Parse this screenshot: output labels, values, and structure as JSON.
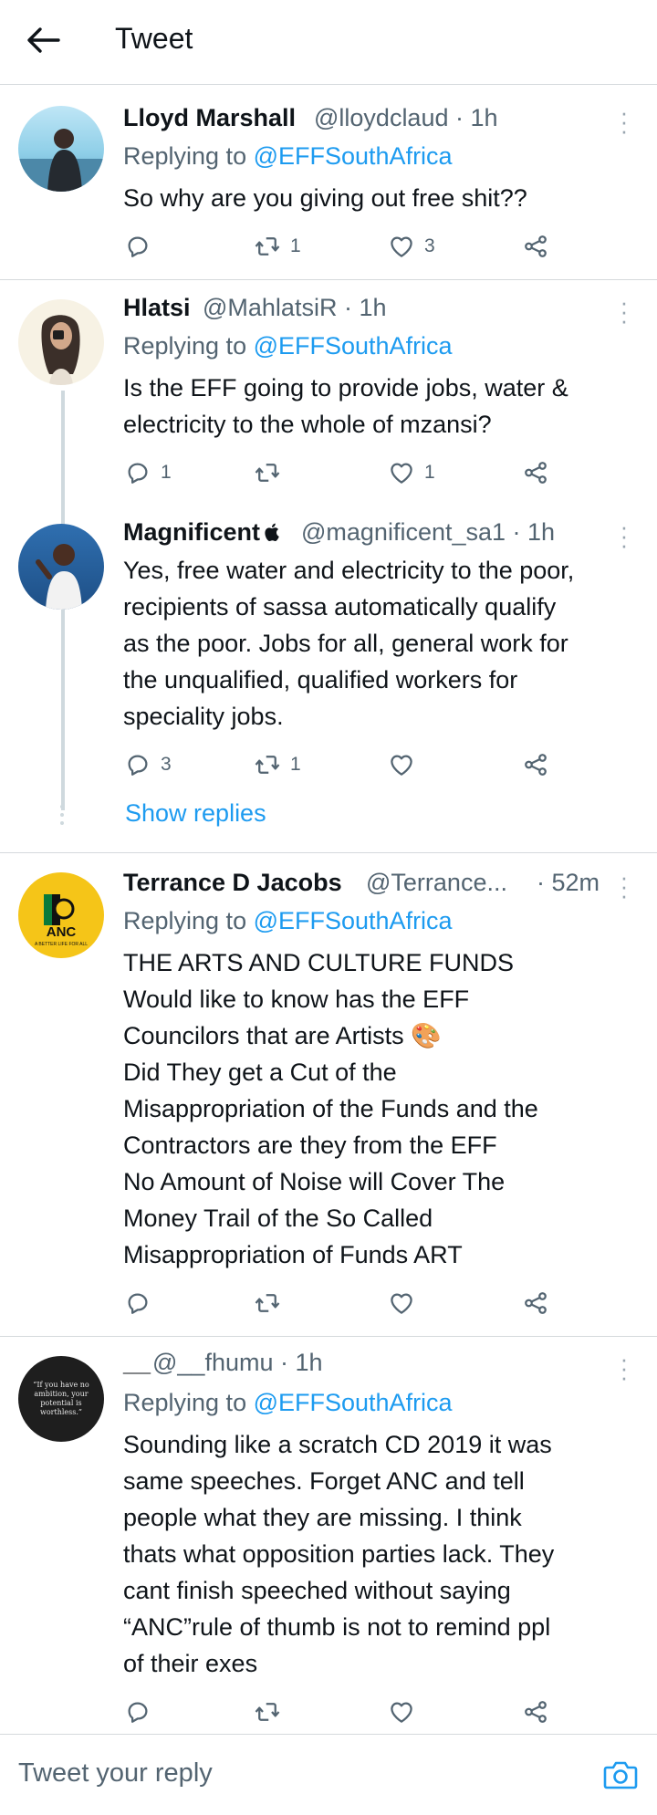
{
  "header": {
    "title": "Tweet"
  },
  "tweets": [
    {
      "name": "Lloyd Marshall",
      "meta": "@lloydclaud · 1h",
      "replying_prefix": "Replying to ",
      "replying_handle": "@EFFSouthAfrica",
      "text": "So why are you giving out free shit??",
      "counts": {
        "reply": "",
        "retweet": "1",
        "like": "3"
      }
    },
    {
      "name": "Hlatsi",
      "meta": "@MahlatsiR · 1h",
      "replying_prefix": "Replying to ",
      "replying_handle": "@EFFSouthAfrica",
      "text": "Is the EFF going to provide jobs, water &\nelectricity to the whole of mzansi?",
      "counts": {
        "reply": "1",
        "retweet": "",
        "like": "1"
      }
    },
    {
      "name": "Magnificent",
      "meta": "@magnificent_sa1 · 1h",
      "text": "Yes, free water and electricity to the poor,\nrecipients of sassa automatically qualify\nas the poor. Jobs for all, general work for\nthe unqualified, qualified workers for\nspeciality jobs.",
      "counts": {
        "reply": "3",
        "retweet": "1",
        "like": ""
      }
    },
    {
      "name": "Terrance D Jacobs",
      "meta": "@Terrance...",
      "time": "· 52m",
      "replying_prefix": "Replying to ",
      "replying_handle": "@EFFSouthAfrica",
      "text": "THE ARTS AND CULTURE FUNDS\nWould like to know has the EFF\nCouncilors that are Artists 🎨\nDid They get a Cut of the\nMisappropriation of the Funds and the\nContractors are they from the EFF\nNo Amount of Noise will Cover The\nMoney Trail of the So Called\nMisappropriation of Funds ART",
      "counts": {
        "reply": "",
        "retweet": "",
        "like": ""
      },
      "avatar_text": {
        "anc": "ANC",
        "slogan": "A BETTER LIFE FOR ALL"
      }
    },
    {
      "name": "__",
      "meta": "@__fhumu · 1h",
      "replying_prefix": "Replying to ",
      "replying_handle": "@EFFSouthAfrica",
      "text": "Sounding like a scratch CD 2019 it was\nsame speeches. Forget ANC and tell\npeople what they are missing. I think\nthats what opposition parties lack. They\ncant finish speeched without saying\n“ANC”rule of thumb is not to remind ppl\nof their exes",
      "counts": {
        "reply": "",
        "retweet": "",
        "like": ""
      },
      "avatar_quote": "“If you have no ambition, your potential is worthless.”"
    }
  ],
  "show_replies": "Show replies",
  "compose": {
    "placeholder": "Tweet your reply"
  },
  "colors": {
    "link": "#1d9bf0",
    "text": "#0f1419",
    "muted": "#536471",
    "divider": "#d5d9dc"
  },
  "icons": [
    "back-arrow-icon",
    "more-icon",
    "reply-icon",
    "retweet-icon",
    "like-icon",
    "share-icon",
    "apple-icon",
    "palette-emoji",
    "camera-icon"
  ]
}
